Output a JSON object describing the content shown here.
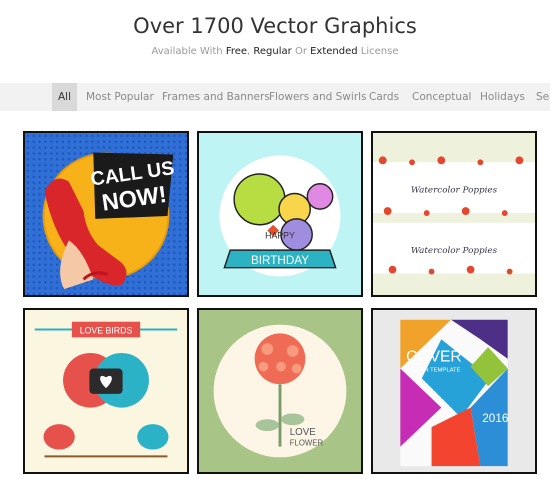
{
  "header": {
    "title": "Over 1700 Vector Graphics",
    "subtitle_prefix": "Available With ",
    "free": "Free",
    "comma": ", ",
    "regular": "Regular",
    "or": " Or ",
    "extended": "Extended",
    "suffix": " License"
  },
  "filters": [
    "All",
    "Most Popular",
    "Frames and Banners",
    "Flowers and Swirls",
    "Cards",
    "Conceptual",
    "Holidays",
    "Sea"
  ],
  "active_filter": "All",
  "tiles": {
    "call": {
      "line1": "CALL US",
      "line2": "NOW!"
    },
    "birthday": {
      "line1": "HAPPY",
      "line2": "BIRTHDAY"
    },
    "poppies": {
      "caption": "Watercolor Poppies"
    },
    "lovebirds": {
      "banner": "LOVE BIRDS"
    },
    "flower": {
      "line1": "LOVE",
      "line2": "FLOWER"
    },
    "cover": {
      "title": "COVER",
      "subtitle": "DESIGN TEMPLATE",
      "year": "2016"
    }
  },
  "colors": {
    "accent_bar": "#f2f2f2",
    "active_tab": "#d9d9d9"
  }
}
